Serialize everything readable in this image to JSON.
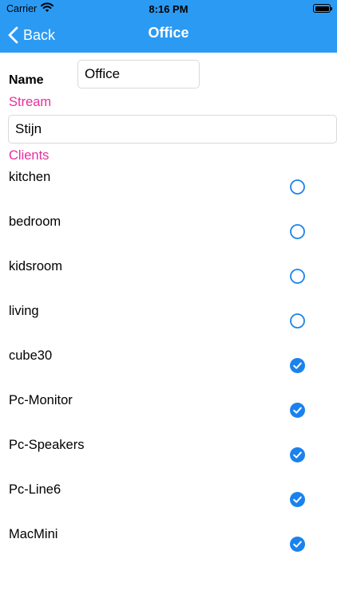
{
  "status_bar": {
    "carrier": "Carrier",
    "time": "8:16 PM",
    "wifi_icon": "wifi-icon",
    "battery_icon": "battery-icon"
  },
  "nav": {
    "back_label": "Back",
    "back_icon": "chevron-left-icon",
    "title": "Office",
    "background_color": "#2b9af3"
  },
  "form": {
    "name_label": "Name",
    "name_value": "Office",
    "stream_label": "Stream",
    "stream_value": "Stijn",
    "clients_label": "Clients",
    "accent_color": "#e72f9c"
  },
  "clients": [
    {
      "name": "kitchen",
      "selected": false
    },
    {
      "name": "bedroom",
      "selected": false
    },
    {
      "name": "kidsroom",
      "selected": false
    },
    {
      "name": "living",
      "selected": false
    },
    {
      "name": "cube30",
      "selected": true
    },
    {
      "name": "Pc-Monitor",
      "selected": true
    },
    {
      "name": "Pc-Speakers",
      "selected": true
    },
    {
      "name": "Pc-Line6",
      "selected": true
    },
    {
      "name": "MacMini",
      "selected": true
    }
  ],
  "check_color": "#1a82ec"
}
